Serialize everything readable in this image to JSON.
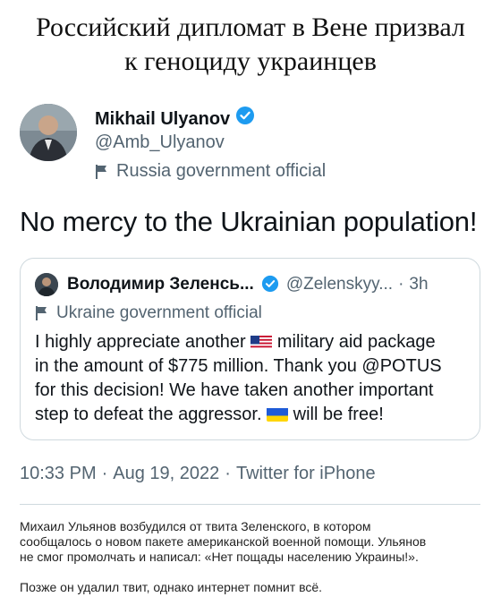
{
  "headline": {
    "line1": "Российский дипломат в Вене призвал",
    "line2": "к геноциду украинцев"
  },
  "author": {
    "name": "Mikhail Ulyanov",
    "handle": "@Amb_Ulyanov",
    "label": "Russia government official",
    "verified_color": "#1d9bf0"
  },
  "tweet": {
    "text": "No mercy to the Ukrainian population!",
    "timestamp": "10:33 PM",
    "date": "Aug 19, 2022",
    "source": "Twitter for iPhone"
  },
  "quoted": {
    "name": "Володимир Зеленсь...",
    "handle": "@Zelenskyy...",
    "time": "3h",
    "label": "Ukraine government official",
    "lines": [
      {
        "pre": "I highly appreciate another ",
        "emoji": "us-flag-emoji",
        "post": " military aid package"
      },
      {
        "pre": "in the amount of $775 million. Thank you @POTUS"
      },
      {
        "pre": "for this decision! We have taken another important"
      },
      {
        "pre": "step to defeat the aggressor. ",
        "emoji": "ukraine-flag-emoji",
        "post": " will be free!"
      }
    ]
  },
  "caption": {
    "lines": [
      "Михаил Ульянов возбудился от твита Зеленского, в котором",
      "сообщалось о новом пакете американской военной помощи. Ульянов",
      "не смог промолчать и написал: «Нет пощады населению Украины!».",
      "",
      "Позже он удалил твит, однако интернет помнит всё."
    ]
  },
  "icons": [
    "verified-badge-icon",
    "government-flag-icon",
    "us-flag-emoji",
    "ukraine-flag-emoji"
  ]
}
